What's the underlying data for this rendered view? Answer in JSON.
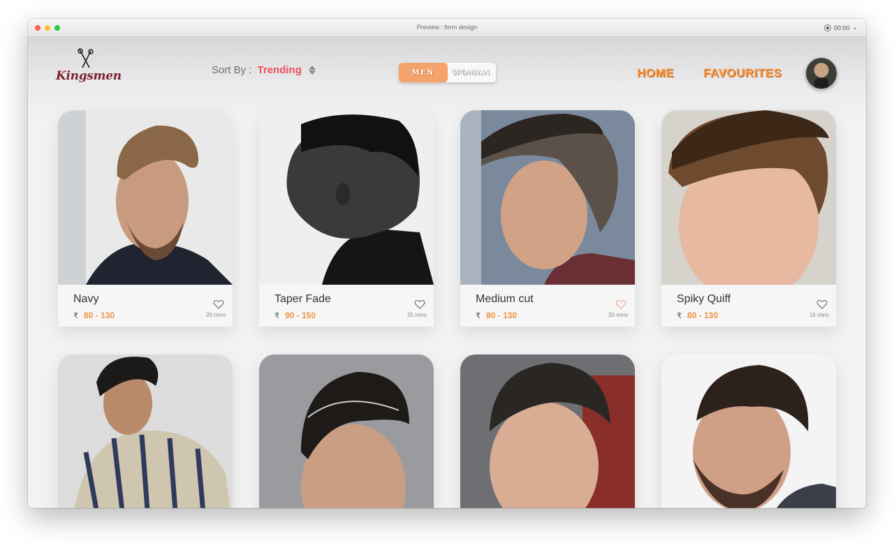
{
  "window": {
    "title": "Preview : form design",
    "record_time": "00:00"
  },
  "header": {
    "logo_text": "Kingsmen",
    "sort_label": "Sort By :",
    "sort_value": "Trending",
    "toggle": {
      "men": "MEN",
      "woman": "WOMAN",
      "selected": "MEN"
    },
    "nav_home": "HOME",
    "nav_favourites": "FAVOURITES"
  },
  "colors": {
    "accent": "#f39542",
    "sort_value": "#e8505b",
    "toggle_active": "#f4a36a",
    "favourite_heart": "#f2a08a"
  },
  "cards": [
    {
      "name": "Navy",
      "currency": "₹",
      "price": "80 - 130",
      "duration": "20 mins",
      "favourite": false,
      "photo": "haircut-photo-navy"
    },
    {
      "name": "Taper Fade",
      "currency": "₹",
      "price": "90 - 150",
      "duration": "25 mins",
      "favourite": false,
      "photo": "haircut-photo-taper-fade"
    },
    {
      "name": "Medium cut",
      "currency": "₹",
      "price": "80 - 130",
      "duration": "20 mins",
      "favourite": true,
      "photo": "haircut-photo-medium-cut"
    },
    {
      "name": "Spiky Quiff",
      "currency": "₹",
      "price": "80 - 130",
      "duration": "15 mins",
      "favourite": false,
      "photo": "haircut-photo-spiky-quiff"
    },
    {
      "photo": "haircut-photo-row2-1"
    },
    {
      "photo": "haircut-photo-row2-2"
    },
    {
      "photo": "haircut-photo-row2-3"
    },
    {
      "photo": "haircut-photo-row2-4"
    }
  ]
}
